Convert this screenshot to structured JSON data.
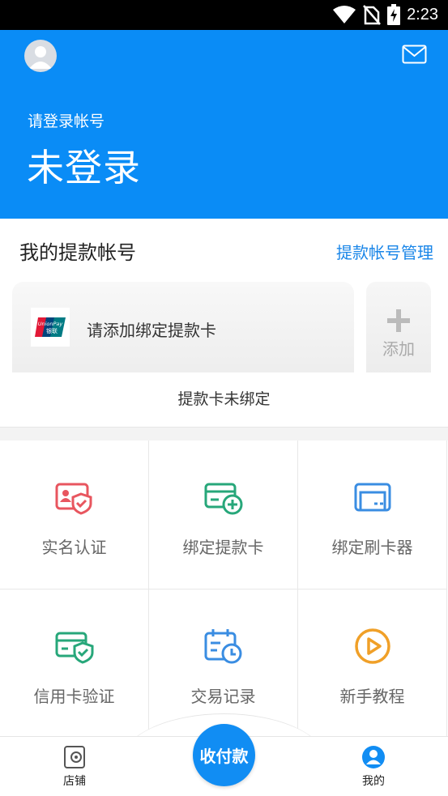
{
  "status_bar": {
    "time": "2:23",
    "icons": [
      "wifi-icon",
      "no-sim-icon",
      "battery-charging-icon"
    ]
  },
  "header": {
    "avatar_icon": "user-avatar-icon",
    "mail_icon": "mail-icon",
    "login_hint": "请登录帐号",
    "login_status": "未登录",
    "background_color": "#0a8cf6"
  },
  "withdraw_section": {
    "title": "我的提款帐号",
    "manage_link": "提款帐号管理",
    "card": {
      "logo_icon": "unionpay-logo",
      "logo_text_top": "UnionPay",
      "logo_text_bottom": "银联",
      "text": "请添加绑定提款卡"
    },
    "add_button": {
      "icon": "plus-icon",
      "label": "添加"
    },
    "status_text": "提款卡未绑定"
  },
  "grid": [
    {
      "label": "实名认证",
      "icon": "id-verify-icon",
      "color": "#e8565f"
    },
    {
      "label": "绑定提款卡",
      "icon": "add-card-icon",
      "color": "#27a77a"
    },
    {
      "label": "绑定刷卡器",
      "icon": "card-reader-icon",
      "color": "#3a8de2"
    },
    {
      "label": "信用卡验证",
      "icon": "card-shield-icon",
      "color": "#27a77a"
    },
    {
      "label": "交易记录",
      "icon": "calendar-clock-icon",
      "color": "#3a8de2"
    },
    {
      "label": "新手教程",
      "icon": "play-circle-icon",
      "color": "#f0a028"
    }
  ],
  "tab_bar": {
    "store": {
      "label": "店铺",
      "icon": "store-wallet-icon"
    },
    "pay": {
      "label": "收付款"
    },
    "mine": {
      "label": "我的",
      "icon": "user-circle-icon",
      "active_color": "#118df3"
    }
  }
}
